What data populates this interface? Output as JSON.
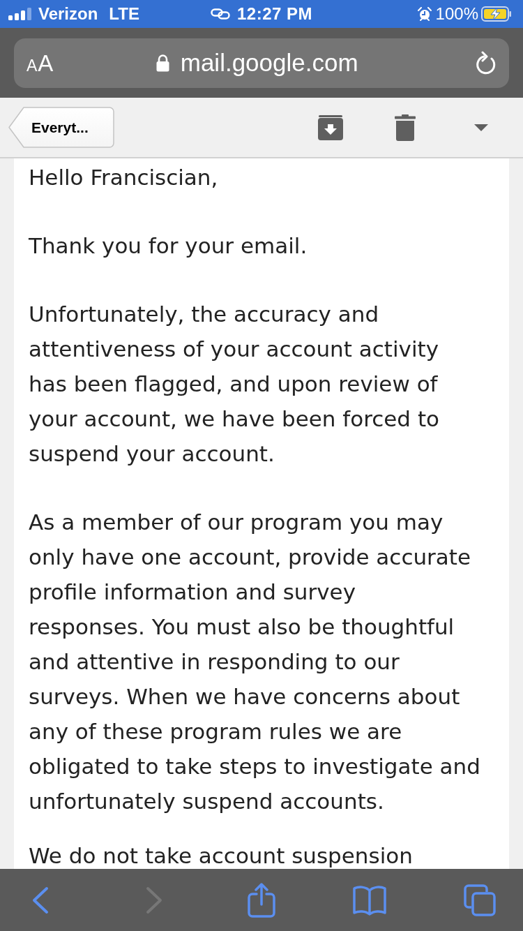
{
  "status_bar": {
    "carrier": "Verizon",
    "network": "LTE",
    "time": "12:27 PM",
    "battery": "100%"
  },
  "address_bar": {
    "text_size_button": "AA",
    "url": "mail.google.com"
  },
  "mail_toolbar": {
    "back_button": "Everyt..."
  },
  "email": {
    "greeting": "Hello Franciscian,",
    "paragraphs": [
      [
        "Thank you for your email."
      ],
      [
        "Unfortunately, the accuracy and",
        "attentiveness of your account activity",
        "has been flagged, and upon review of",
        "your account, we have been forced to",
        "suspend your account."
      ],
      [
        "As a member of our program you may",
        "only have one account, provide accurate",
        "profile information and survey",
        "responses. You must also be thoughtful",
        "and attentive in responding to our",
        "surveys. When we have concerns about",
        "any of these program rules we are",
        "obligated to take steps to investigate and",
        "unfortunately suspend accounts."
      ],
      [
        "We do not take account suspension"
      ]
    ]
  },
  "bottom_bar": {
    "buttons": [
      {
        "kind": "back",
        "disabled": false
      },
      {
        "kind": "forward",
        "disabled": true
      },
      {
        "kind": "share",
        "disabled": false
      },
      {
        "kind": "bookmarks",
        "disabled": false
      },
      {
        "kind": "tabs",
        "disabled": false
      }
    ]
  }
}
